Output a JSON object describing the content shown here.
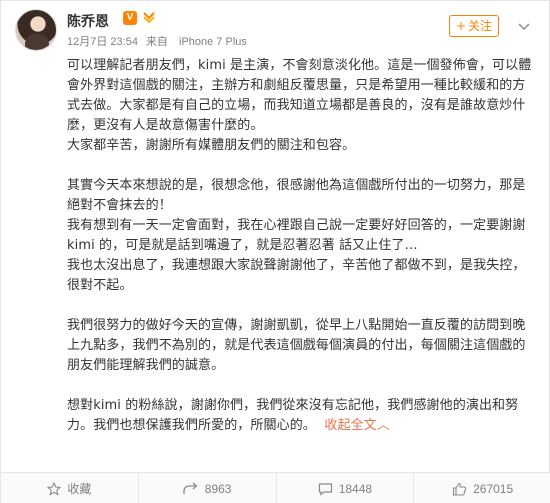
{
  "header": {
    "name": "陈乔恩",
    "verified_badge": "V",
    "timestamp": "12月7日 23:54",
    "source_prefix": "来自",
    "source": "iPhone 7 Plus",
    "follow_label": "关注",
    "follow_plus": "+"
  },
  "post": {
    "paragraphs": [
      "可以理解記者朋友們，kimi 是主演，不會刻意淡化他。這是一個發佈會，可以體會外界對這個戲的關注，主辦方和劇組反覆思量，只是希望用一種比較緩和的方式去做。大家都是有自己的立場，而我知道立場都是善良的，沒有是誰故意炒什麼，更沒有人是故意傷害什麼的。",
      "大家都辛苦，謝謝所有媒體朋友們的關注和包容。",
      "",
      "其實今天本來想說的是，很想念他，很感謝他為這個戲所付出的一切努力，那是絕對不會抹去的！",
      "我有想到有一天一定會面對，我在心裡跟自己說一定要好好回答的，一定要謝謝 kimi 的，可是就是話到嘴邊了，就是忍著忍著 話又止住了…",
      "我也太沒出息了，我連想跟大家說聲謝謝他了，辛苦他了都做不到，是我失控，很對不起。",
      "",
      "我們很努力的做好今天的宣傳，謝謝凱凱，從早上八點開始一直反覆的訪問到晚上九點多，我們不為別的，就是代表這個戲每個演員的付出，每個關注這個戲的朋友們能理解我們的誠意。",
      "",
      "想對kimi 的粉絲說，謝謝你們，我們從來沒有忘記他，我們感謝他的演出和努力。我們也想保護我們所愛的，所關心的。"
    ],
    "collapse_label": "收起全文",
    "collapse_arrow": "︿"
  },
  "actions": {
    "favorite_label": "收藏",
    "repost_count": "8963",
    "comment_count": "18448",
    "like_count": "267015"
  },
  "colors": {
    "accent": "#ff8200",
    "link": "#eb7350",
    "muted": "#808080"
  }
}
